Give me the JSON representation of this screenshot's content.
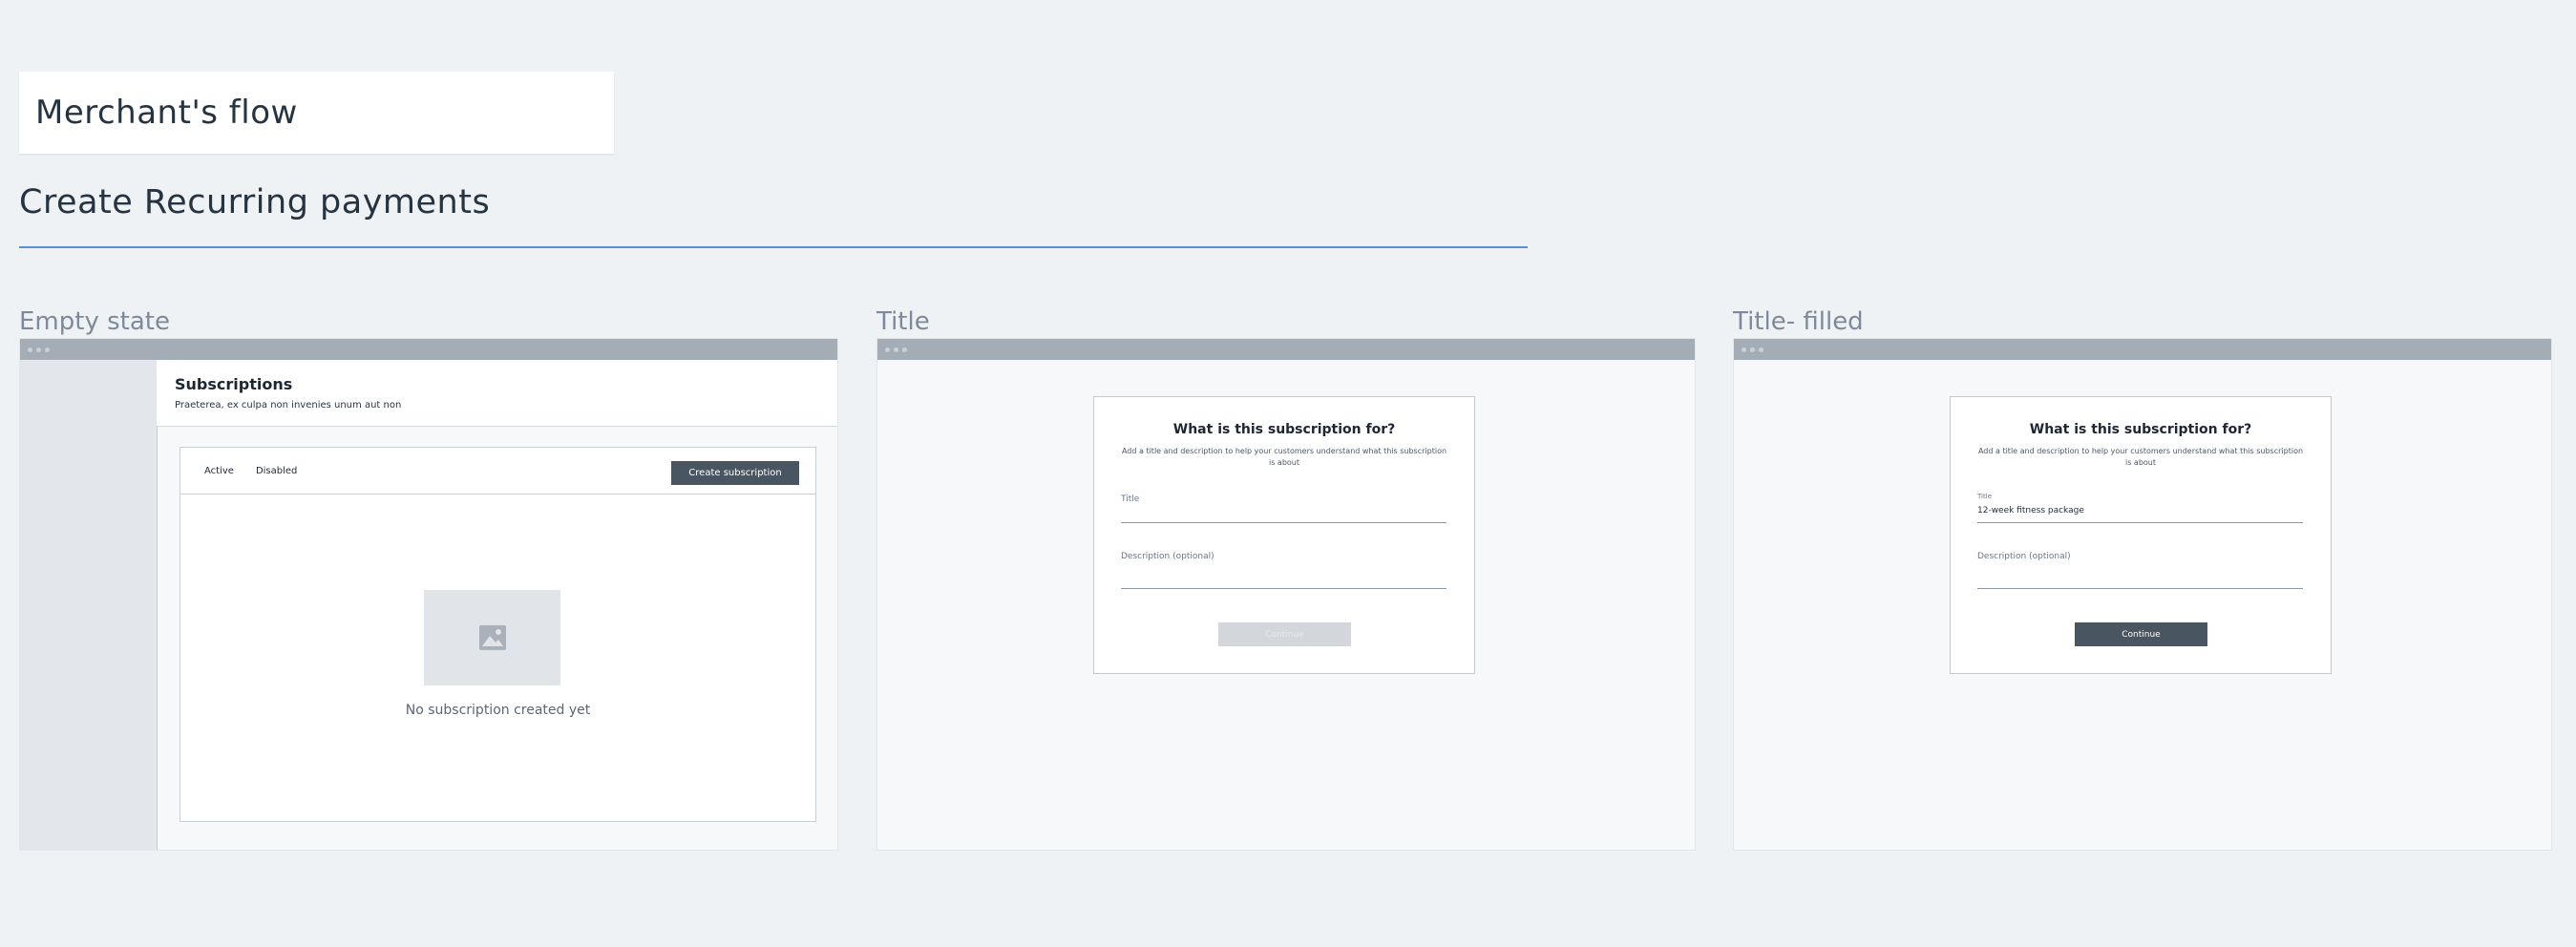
{
  "page": {
    "flow_title": "Merchant's flow",
    "section_title": "Create Recurring payments"
  },
  "frames": [
    {
      "label": "Empty state",
      "header": {
        "title": "Subscriptions",
        "subtitle": "Praeterea, ex culpa non invenies unum aut non"
      },
      "tabs": [
        "Active",
        "Disabled"
      ],
      "create_button": "Create subscription",
      "empty_icon": "image-placeholder-icon",
      "empty_message": "No subscription created yet"
    },
    {
      "label": "Title",
      "modal": {
        "title": "What is this subscription for?",
        "subtitle": "Add a title and description to help your customers understand what this subscription is about",
        "title_field_label": "Title",
        "title_field_value": "",
        "description_label": "Description (optional)",
        "button": "Continue",
        "button_state": "disabled"
      }
    },
    {
      "label": "Title- filled",
      "modal": {
        "title": "What is this subscription for?",
        "subtitle": "Add a title and description to help your customers understand what this subscription is about",
        "title_field_label": "Title",
        "title_field_value": "12-week fitness package",
        "description_label": "Description (optional)",
        "button": "Continue",
        "button_state": "enabled"
      }
    }
  ],
  "colors": {
    "background": "#eff2f5",
    "divider_accent": "#5b8ed6",
    "primary_button": "#4a5562",
    "disabled_button": "#d3d7dc",
    "frame_bar": "#a4acb6"
  }
}
